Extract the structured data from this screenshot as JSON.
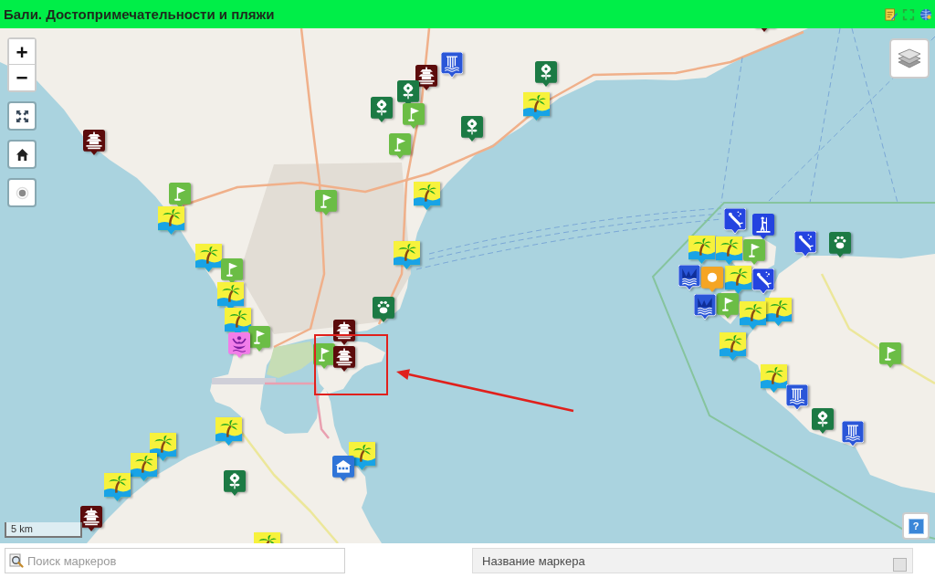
{
  "title_bar": {
    "title": "Бали. Достопримечательности и пляжи"
  },
  "map": {
    "zoom_control": {
      "zoom_in": "+",
      "zoom_out": "−"
    },
    "markers": [
      {
        "kind": "temple"
      },
      {
        "kind": "waterfall"
      },
      {
        "kind": "temple"
      },
      {
        "kind": "flower"
      },
      {
        "kind": "flower"
      },
      {
        "kind": "flower"
      },
      {
        "kind": "flag"
      },
      {
        "kind": "beach"
      },
      {
        "kind": "flower"
      },
      {
        "kind": "flag"
      },
      {
        "kind": "temple"
      },
      {
        "kind": "flag"
      },
      {
        "kind": "beach"
      },
      {
        "kind": "flag"
      },
      {
        "kind": "beach"
      },
      {
        "kind": "beach"
      },
      {
        "kind": "beach"
      },
      {
        "kind": "flag"
      },
      {
        "kind": "beach"
      },
      {
        "kind": "beach"
      },
      {
        "kind": "paw"
      },
      {
        "kind": "flag"
      },
      {
        "kind": "spa"
      },
      {
        "kind": "temple"
      },
      {
        "kind": "flag"
      },
      {
        "kind": "temple"
      },
      {
        "kind": "beach"
      },
      {
        "kind": "beach"
      },
      {
        "kind": "beach"
      },
      {
        "kind": "beach"
      },
      {
        "kind": "beach"
      },
      {
        "kind": "building"
      },
      {
        "kind": "flower"
      },
      {
        "kind": "temple"
      },
      {
        "kind": "beach"
      },
      {
        "kind": "diving"
      },
      {
        "kind": "paddleboard"
      },
      {
        "kind": "beach"
      },
      {
        "kind": "beach"
      },
      {
        "kind": "flag"
      },
      {
        "kind": "diving"
      },
      {
        "kind": "paw"
      },
      {
        "kind": "pool"
      },
      {
        "kind": "beach"
      },
      {
        "kind": "sun"
      },
      {
        "kind": "diving"
      },
      {
        "kind": "flag"
      },
      {
        "kind": "pool"
      },
      {
        "kind": "beach"
      },
      {
        "kind": "beach"
      },
      {
        "kind": "beach"
      },
      {
        "kind": "beach"
      },
      {
        "kind": "waterfall"
      },
      {
        "kind": "flower"
      },
      {
        "kind": "waterfall"
      },
      {
        "kind": "flag"
      }
    ],
    "scale": "5 km",
    "help": "?"
  },
  "annotations": [
    {
      "kind": "frame"
    },
    {
      "kind": "arrow"
    }
  ],
  "bottom_bar": {
    "search": {
      "placeholder": "Поиск маркеров"
    },
    "marker_name": {
      "placeholder": "Название маркера"
    }
  }
}
